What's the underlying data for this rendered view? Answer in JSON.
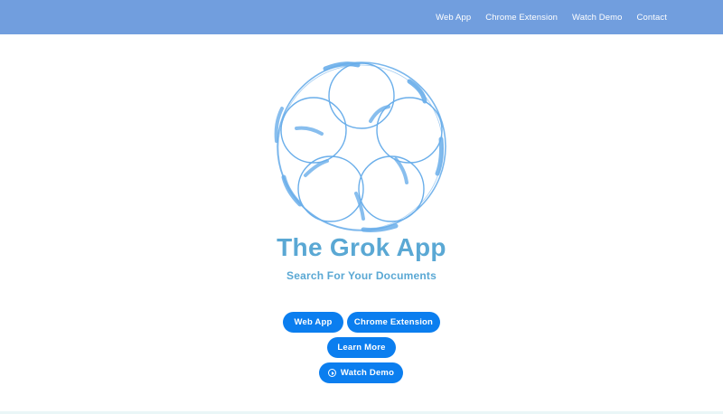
{
  "nav": {
    "links": [
      {
        "label": "Web App"
      },
      {
        "label": "Chrome Extension"
      },
      {
        "label": "Watch Demo"
      },
      {
        "label": "Contact"
      }
    ]
  },
  "hero": {
    "title": "The Grok App",
    "subtitle": "Search For Your Documents"
  },
  "buttons": {
    "web_app": "Web App",
    "chrome_extension": "Chrome Extension",
    "learn_more": "Learn More",
    "watch_demo": "Watch Demo",
    "watch_demo_icon": "play-circle-icon"
  },
  "colors": {
    "nav_background": "#719ede",
    "button": "#0b7eef",
    "title": "#5aa8d4",
    "logo_stroke": "#6aaeea"
  }
}
